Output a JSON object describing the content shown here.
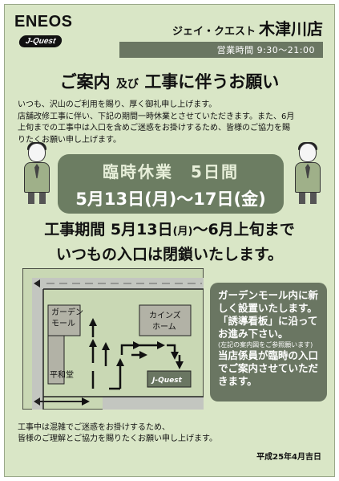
{
  "brand": {
    "name": "ENEOS",
    "sub": "J-Quest"
  },
  "store": {
    "kana": "ジェイ・クエスト",
    "name": "木津川店"
  },
  "hours": "営業時間 9:30〜21:00",
  "headline": {
    "part1": "ご案内",
    "part2": "及び",
    "part3": "工事に伴うお願い"
  },
  "intro": {
    "lines": [
      "いつも、沢山のご利用を賜り、厚く御礼申し上げます。",
      "店舗改修工事に伴い、下記の期間一時休業とさせていただきます。また、6月",
      "上旬までの工事中は入口を含めご迷惑をお掛けするため、皆様のご協力を賜",
      "りたくお願い申し上げます。"
    ]
  },
  "closure": {
    "title": "臨時休業　5日間",
    "dates": "5月13日(月)〜17日(金)"
  },
  "period": {
    "a": "工事期間",
    "b": "5月13日",
    "c": "(月)",
    "d": "〜6月上旬まで",
    "line2": "いつもの入口は閉鎖いたします。"
  },
  "map": {
    "garden": "ガーデン\nモール",
    "cainz": "カインズ\nホーム",
    "heiwado": "平和堂",
    "jquest": "J-Quest"
  },
  "guide": {
    "line1": "ガーデンモール内に新しく設置いたします。",
    "line2": "「誘導看板」に沿ってお進み下さい。",
    "note": "(左記の案内図をご参照願います)",
    "line3": "当店係員が臨時の入口でご案内させていただきます。"
  },
  "footer": {
    "line1": "工事中は混雑でご迷惑をお掛けするため、",
    "line2": "皆様のご理解とご協力を賜りたくお願い申し上げます。"
  },
  "date": "平成25年4月吉日"
}
